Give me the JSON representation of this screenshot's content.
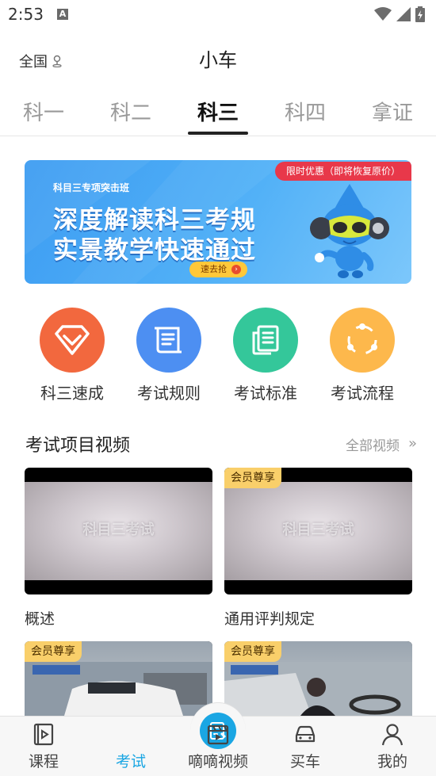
{
  "status_bar": {
    "time": "2:53",
    "a_icon_label": "A"
  },
  "header": {
    "location": "全国",
    "title": "小车"
  },
  "tabs": [
    {
      "label": "科一",
      "active": false
    },
    {
      "label": "科二",
      "active": false
    },
    {
      "label": "科三",
      "active": true
    },
    {
      "label": "科四",
      "active": false
    },
    {
      "label": "拿证",
      "active": false
    }
  ],
  "banner": {
    "tag": "限时优惠（即将恢复原价）",
    "subtitle": "科目三专项突击班",
    "line1": "深度解读科三考规",
    "line2": "实景教学快速通过",
    "cta": "速去抢"
  },
  "quick_links": [
    {
      "label": "科三速成",
      "icon": "diamond-icon",
      "color": "#f2683e"
    },
    {
      "label": "考试规则",
      "icon": "scroll-icon",
      "color": "#4d8ff2"
    },
    {
      "label": "考试标准",
      "icon": "document-icon",
      "color": "#34c79a"
    },
    {
      "label": "考试流程",
      "icon": "cycle-icon",
      "color": "#fdb84c"
    }
  ],
  "section": {
    "title": "考试项目视频",
    "more": "全部视频"
  },
  "videos": [
    {
      "title": "概述",
      "badge": "",
      "thumb_text": "科目三考试"
    },
    {
      "title": "通用评判规定",
      "badge": "会员尊享",
      "thumb_text": "科目三考试"
    },
    {
      "title": "",
      "badge": "会员尊享",
      "thumb_text": ""
    },
    {
      "title": "",
      "badge": "会员尊享",
      "thumb_text": ""
    }
  ],
  "bottom_nav": [
    {
      "label": "课程",
      "icon": "video-book-icon",
      "active": false
    },
    {
      "label": "考试",
      "icon": "exam-icon",
      "active": true
    },
    {
      "label": "嘀嘀视频",
      "icon": "clapper-icon",
      "active": false
    },
    {
      "label": "买车",
      "icon": "car-icon",
      "active": false
    },
    {
      "label": "我的",
      "icon": "user-icon",
      "active": false
    }
  ],
  "colors": {
    "accent": "#1aa6e3",
    "banner_tag": "#e8384a",
    "member_badge": "#f9cf6a"
  }
}
